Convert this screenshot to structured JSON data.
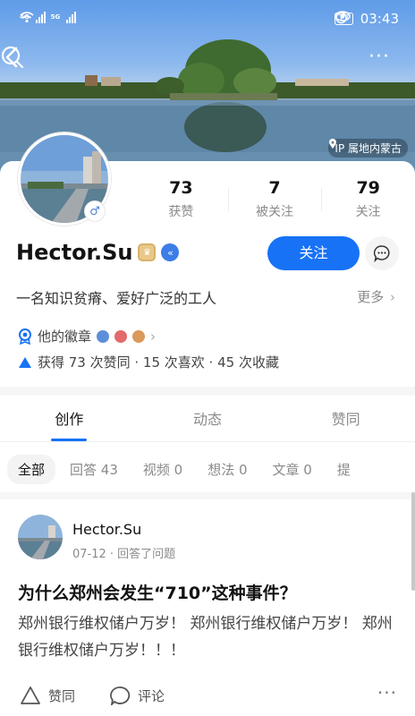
{
  "status_bar": {
    "network_1": "4G",
    "network_2": "5G",
    "battery": "17",
    "time": "03:43"
  },
  "cover": {
    "location": "IP 属地内蒙古"
  },
  "profile": {
    "name": "Hector.Su",
    "bio": "一名知识贫瘠、爱好广泛的工人",
    "bio_more": "更多",
    "stats": [
      {
        "value": "73",
        "label": "获赞"
      },
      {
        "value": "7",
        "label": "被关注"
      },
      {
        "value": "79",
        "label": "关注"
      }
    ],
    "follow_label": "关注",
    "medals_label": "他的徽章",
    "achievements": "获得 73 次赞同 · 15 次喜欢 · 45 次收藏"
  },
  "tabs": [
    {
      "label": "创作"
    },
    {
      "label": "动态"
    },
    {
      "label": "赞同"
    }
  ],
  "filters": [
    {
      "label": "全部"
    },
    {
      "label": "回答 43"
    },
    {
      "label": "视频 0"
    },
    {
      "label": "想法 0"
    },
    {
      "label": "文章 0"
    },
    {
      "label": "提"
    }
  ],
  "post": {
    "author": "Hector.Su",
    "meta": "07-12 · 回答了问题",
    "title": "为什么郑州会发生“710”这种事件？",
    "excerpt": "郑州银行维权储户万岁！ 郑州银行维权储户万岁！ 郑州银行维权储户万岁！！！",
    "like_label": "赞同",
    "comment_label": "评论"
  },
  "colors": {
    "accent": "#1772f6",
    "muted": "#8a8a8a",
    "text": "#121212"
  },
  "icons": [
    "back-icon",
    "search-icon",
    "more-icon",
    "location-icon",
    "gender-male-icon",
    "chat-icon",
    "chevron-right-icon",
    "medal-icon",
    "triangle-up-icon",
    "comment-icon"
  ]
}
